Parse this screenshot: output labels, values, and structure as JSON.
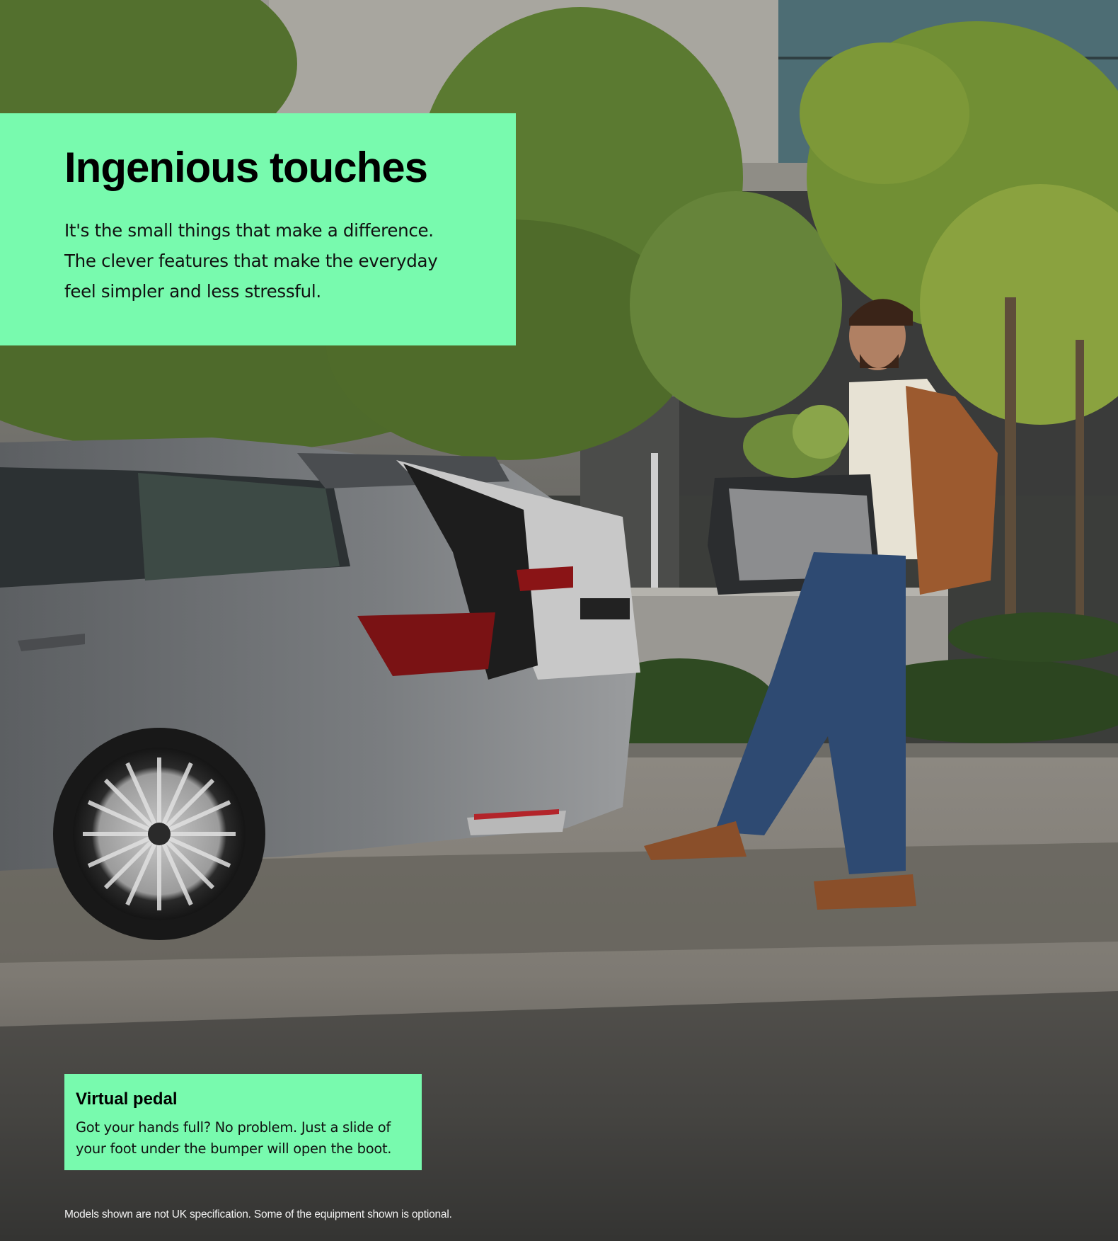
{
  "intro": {
    "title": "Ingenious touches",
    "body": "It's the small things that make a difference. The clever features that make the everyday feel simpler and less stressful."
  },
  "feature": {
    "title": "Virtual pedal",
    "body": "Got your hands full? No problem. Just a slide of your foot under the bumper will open the boot."
  },
  "disclaimer": "Models shown are not UK specification. Some of the equipment shown is optional.",
  "colors": {
    "panel_green": "#78faae",
    "car_grey": "#6f7275",
    "foliage": "#4f6b2a"
  },
  "photo": {
    "subject": "estate car with open boot, man carrying bag and plant"
  }
}
